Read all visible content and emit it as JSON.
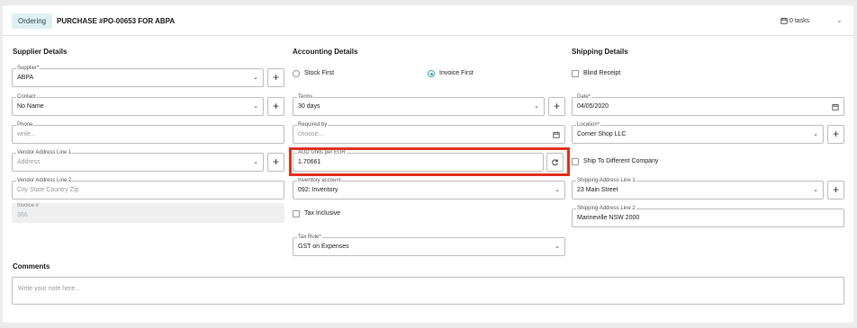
{
  "header": {
    "badge": "Ordering",
    "title": "PURCHASE #PO-00653 FOR ABPA",
    "tasks": "0 tasks"
  },
  "supplier": {
    "title": "Supplier Details",
    "supplier_label": "Supplier*",
    "supplier_value": "ABPA",
    "contact_label": "Contact",
    "contact_value": "No Name",
    "phone_label": "Phone",
    "phone_placeholder": "write...",
    "addr1_label": "Vendor Address Line 1",
    "addr1_placeholder": "Address",
    "addr2_label": "Vendor Address Line 2",
    "addr2_placeholder": "City State Country Zip",
    "invoice_label": "Invoice #",
    "invoice_value": "366"
  },
  "accounting": {
    "title": "Accounting Details",
    "stock_first": "Stock First",
    "invoice_first": "Invoice First",
    "terms_label": "Terms",
    "terms_value": "30 days",
    "required_by_label": "Required by",
    "required_by_placeholder": "choose...",
    "fx_label": "AUD Units per EUR",
    "fx_value": "1.70661",
    "inventory_label": "Inventory account",
    "inventory_value": "092: Inventory",
    "tax_inclusive": "Tax Inclusive",
    "tax_rule_label": "Tax Rule*",
    "tax_rule_value": "GST on Expenses"
  },
  "shipping": {
    "title": "Shipping Details",
    "blind_receipt": "Blind Receipt",
    "date_label": "Date*",
    "date_value": "04/05/2020",
    "location_label": "Location*",
    "location_value": "Corner Shop LLC",
    "ship_different": "Ship To Different Company",
    "line1_label": "Shipping Address Line 1",
    "line1_value": "23 Main Street",
    "line2_label": "Shipping Address Line 2",
    "line2_value": "Marineville NSW 2000"
  },
  "comments": {
    "title": "Comments",
    "placeholder": "Write your note here..."
  },
  "colors": {
    "accent": "#3aa8b8",
    "highlight": "#e0321f",
    "badge_bg": "#dff0f3"
  }
}
